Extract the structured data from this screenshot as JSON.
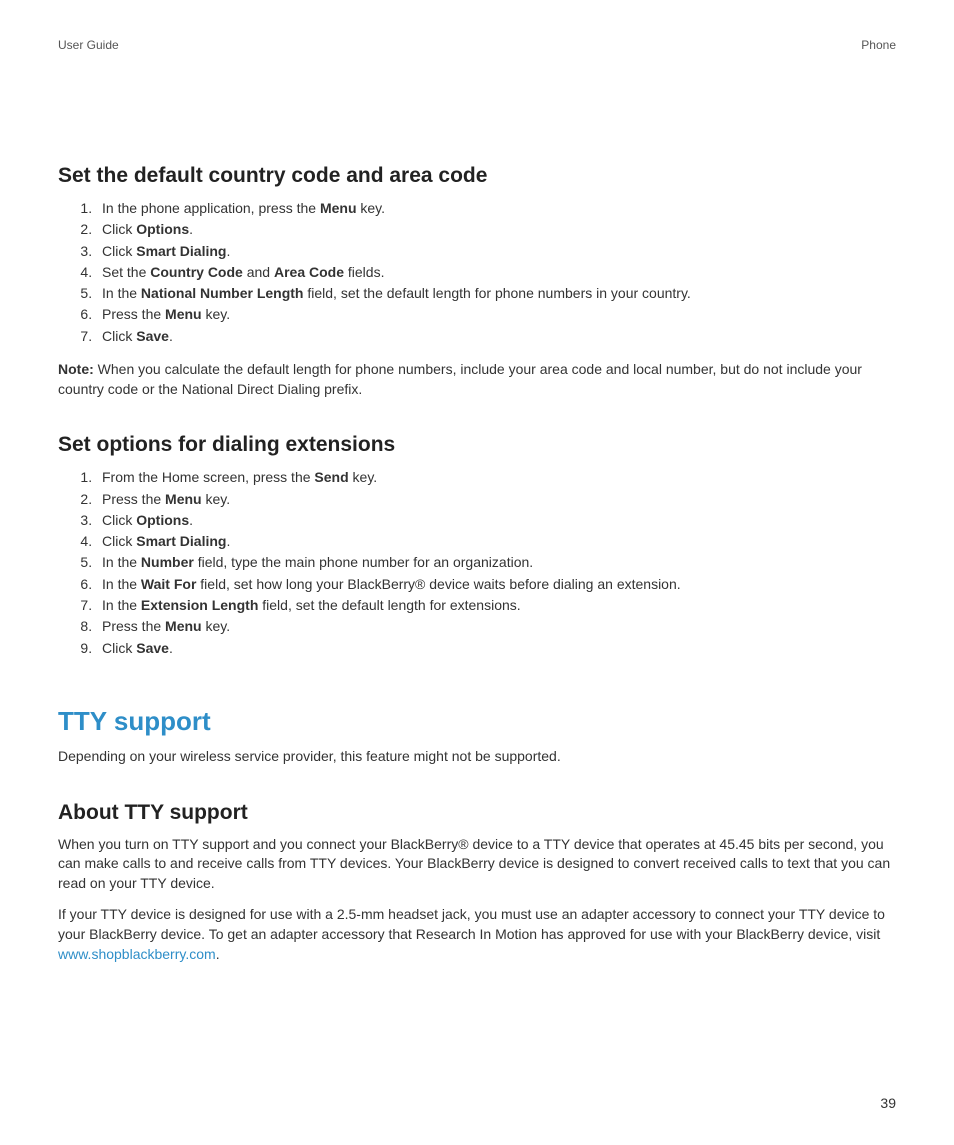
{
  "header": {
    "left": "User Guide",
    "right": "Phone"
  },
  "sec1": {
    "title": "Set the default country code and area code",
    "s1a": "In the phone application, press the ",
    "s1b": "Menu",
    "s1c": " key.",
    "s2a": "Click ",
    "s2b": "Options",
    "s2c": ".",
    "s3a": "Click ",
    "s3b": "Smart Dialing",
    "s3c": ".",
    "s4a": "Set the ",
    "s4b": "Country Code",
    "s4c": " and ",
    "s4d": "Area Code",
    "s4e": " fields.",
    "s5a": "In the ",
    "s5b": "National Number Length",
    "s5c": " field, set the default length for phone numbers in your country.",
    "s6a": "Press the ",
    "s6b": "Menu",
    "s6c": " key.",
    "s7a": "Click ",
    "s7b": "Save",
    "s7c": ".",
    "noteLabel": "Note:",
    "note": "  When you calculate the default length for phone numbers, include your area code and local number, but do not include your country code or the National Direct Dialing prefix."
  },
  "sec2": {
    "title": "Set options for dialing extensions",
    "s1a": "From the Home screen, press the ",
    "s1b": "Send",
    "s1c": " key.",
    "s2a": "Press the ",
    "s2b": "Menu",
    "s2c": " key.",
    "s3a": "Click ",
    "s3b": "Options",
    "s3c": ".",
    "s4a": "Click ",
    "s4b": "Smart Dialing",
    "s4c": ".",
    "s5a": "In the ",
    "s5b": "Number",
    "s5c": " field, type the main phone number for an organization.",
    "s6a": "In the ",
    "s6b": "Wait For",
    "s6c": " field, set how long your BlackBerry® device waits before dialing an extension.",
    "s7a": "In the ",
    "s7b": "Extension Length",
    "s7c": " field, set the default length for extensions.",
    "s8a": "Press the ",
    "s8b": "Menu",
    "s8c": " key.",
    "s9a": "Click ",
    "s9b": "Save",
    "s9c": "."
  },
  "sec3": {
    "title": "TTY support",
    "intro": "Depending on your wireless service provider, this feature might not be supported."
  },
  "sec4": {
    "title": "About TTY support",
    "p1": "When you turn on TTY support and you connect your BlackBerry® device to a TTY device that operates at 45.45 bits per second, you can make calls to and receive calls from TTY devices. Your BlackBerry device is designed to convert received calls to text that you can read on your TTY device.",
    "p2a": "If your TTY device is designed for use with a 2.5-mm headset jack, you must use an adapter accessory to connect your TTY device to your BlackBerry device. To get an adapter accessory that Research In Motion has approved for use with your BlackBerry device, visit ",
    "link": "www.shopblackberry.com",
    "p2b": "."
  },
  "pageNum": "39"
}
